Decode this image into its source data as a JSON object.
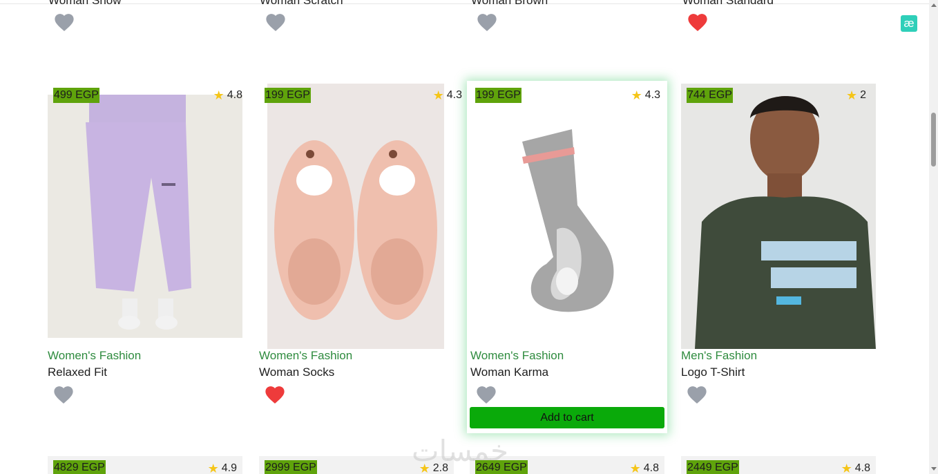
{
  "top_row": {
    "titles": [
      "Woman Snow",
      "Woman Scratch",
      "Woman Brown",
      "Woman Standard"
    ],
    "favorites": [
      false,
      false,
      false,
      true
    ]
  },
  "products": [
    {
      "price": "499 EGP",
      "rating": "4.8",
      "category": "Women's Fashion",
      "name": "Relaxed Fit",
      "favorite": false
    },
    {
      "price": "199 EGP",
      "rating": "4.3",
      "category": "Women's Fashion",
      "name": "Woman Socks",
      "favorite": true
    },
    {
      "price": "199 EGP",
      "rating": "4.3",
      "category": "Women's Fashion",
      "name": "Woman Karma",
      "favorite": false,
      "add_to_cart": "Add to cart"
    },
    {
      "price": "744 EGP",
      "rating": "2",
      "category": "Men's Fashion",
      "name": "Logo T-Shirt",
      "favorite": false
    }
  ],
  "bottom_row": [
    {
      "price": "4829 EGP",
      "rating": "4.9"
    },
    {
      "price": "2999 EGP",
      "rating": "2.8"
    },
    {
      "price": "2649 EGP",
      "rating": "4.8"
    },
    {
      "price": "2449 EGP",
      "rating": "4.8"
    }
  ],
  "badge": "æ",
  "watermark": "خمسات",
  "colors": {
    "price_bg": "#5fa30b",
    "category": "#2e8b3e",
    "add_to_cart": "#0aaa0a",
    "heart_active": "#ee3b3b",
    "heart_inactive": "#9aa0aa",
    "star": "#f5c518"
  },
  "icons": {
    "favorite": "heart-icon",
    "rating": "star-icon",
    "badge": "ae-extension-icon"
  }
}
